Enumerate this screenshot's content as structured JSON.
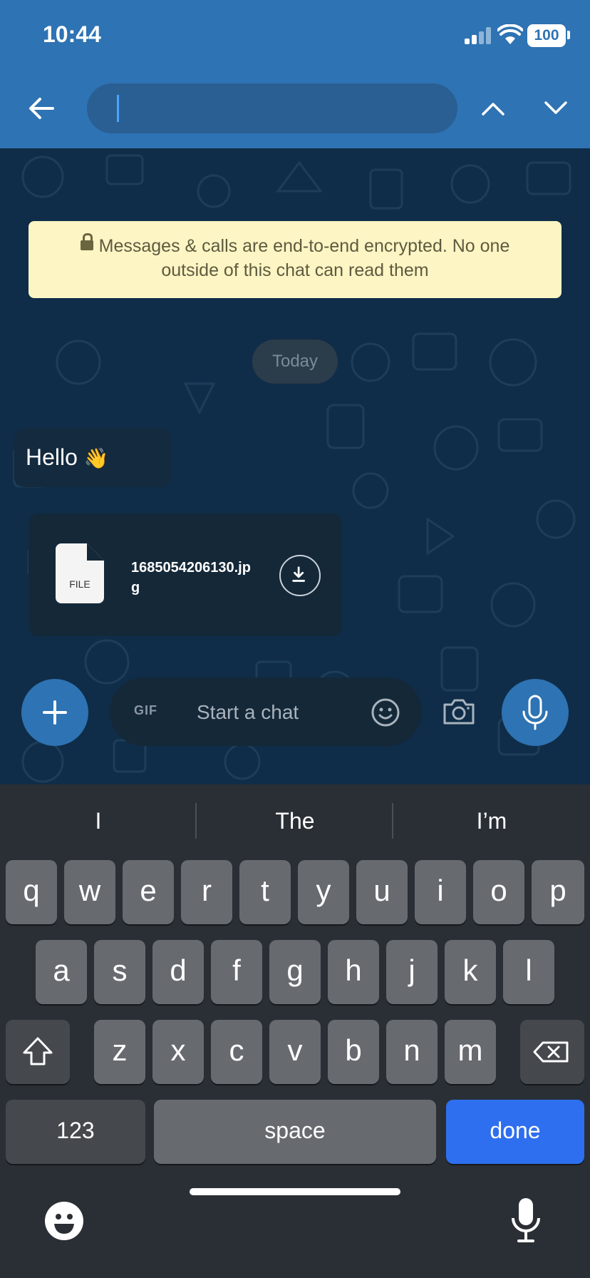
{
  "status_bar": {
    "time": "10:44",
    "battery": "100"
  },
  "header": {
    "search_value": "",
    "search_placeholder": ""
  },
  "chat": {
    "encryption_notice": "Messages & calls are end-to-end encrypted. No one outside of this chat can read them",
    "date_separator": "Today",
    "messages": [
      {
        "type": "text",
        "text": "Hello",
        "emoji": "👋"
      },
      {
        "type": "file",
        "file_label": "FILE",
        "file_name": "1685054206130.jpg"
      }
    ]
  },
  "composer": {
    "gif_label": "GIF",
    "placeholder": "Start a chat"
  },
  "keyboard": {
    "suggestions": [
      "I",
      "The",
      "I’m"
    ],
    "row1": [
      "q",
      "w",
      "e",
      "r",
      "t",
      "y",
      "u",
      "i",
      "o",
      "p"
    ],
    "row2": [
      "a",
      "s",
      "d",
      "f",
      "g",
      "h",
      "j",
      "k",
      "l"
    ],
    "row3": [
      "z",
      "x",
      "c",
      "v",
      "b",
      "n",
      "m"
    ],
    "numbers_label": "123",
    "space_label": "space",
    "done_label": "done"
  },
  "colors": {
    "accent": "#2e73b3",
    "done_key": "#2e6ff0",
    "notice_bg": "#fdf5c4"
  },
  "icons": [
    "back-arrow-icon",
    "chevron-up-icon",
    "chevron-down-icon",
    "lock-icon",
    "file-icon",
    "download-icon",
    "plus-icon",
    "smiley-icon",
    "camera-icon",
    "microphone-icon",
    "shift-icon",
    "backspace-icon",
    "emoji-icon"
  ]
}
